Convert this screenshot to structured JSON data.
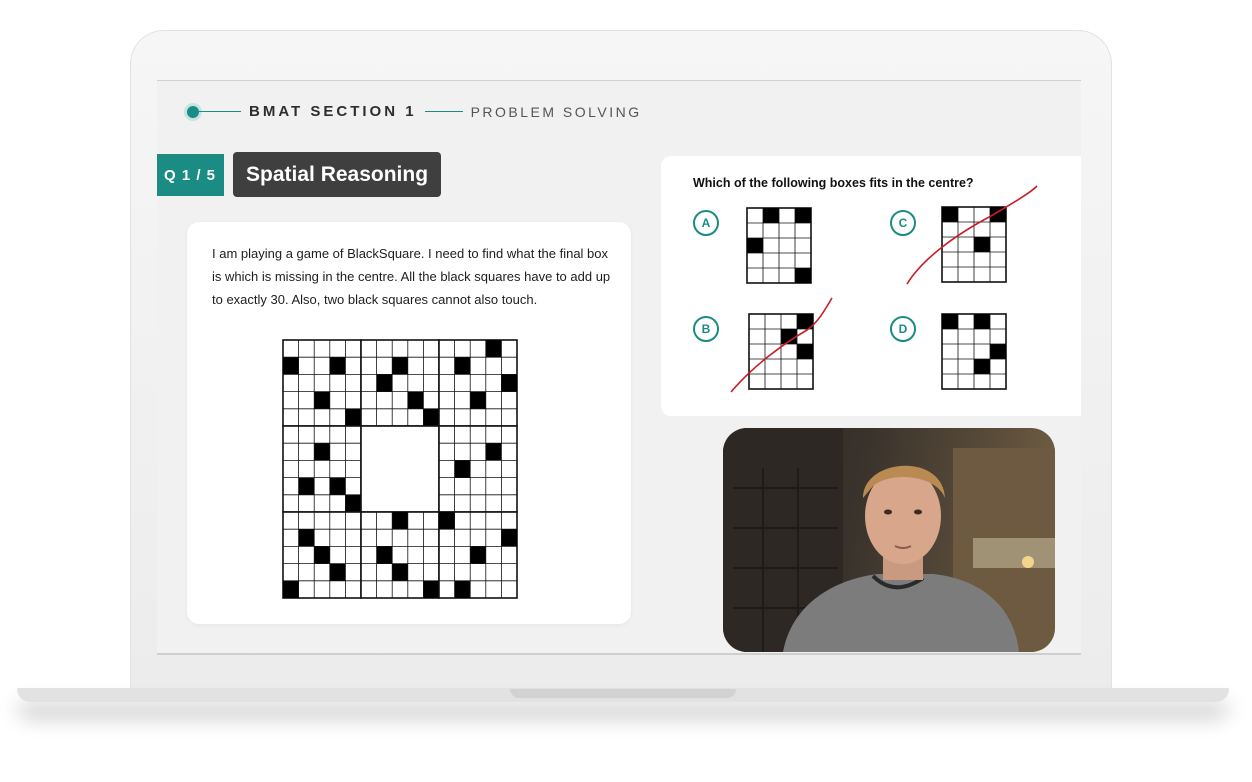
{
  "breadcrumb": {
    "main": "BMAT SECTION 1",
    "sub": "PROBLEM SOLVING"
  },
  "question": {
    "badge": "Q 1 / 5",
    "topic": "Spatial Reasoning",
    "text": "I am playing a game of BlackSquare. I need to find what the final box is which is missing in the centre. All the black squares have to add up to exactly 30. Also, two black squares cannot also touch."
  },
  "answers": {
    "prompt": "Which of the following boxes fits in the centre?",
    "options": [
      {
        "letter": "A",
        "crossed": false
      },
      {
        "letter": "B",
        "crossed": true
      },
      {
        "letter": "C",
        "crossed": true
      },
      {
        "letter": "D",
        "crossed": false
      }
    ]
  },
  "colors": {
    "accent": "#1a8c84",
    "topic_bg": "#3f3f3f",
    "strike": "#c81d25"
  },
  "icons": {
    "progress": "dot-icon",
    "video": "video-feed"
  }
}
